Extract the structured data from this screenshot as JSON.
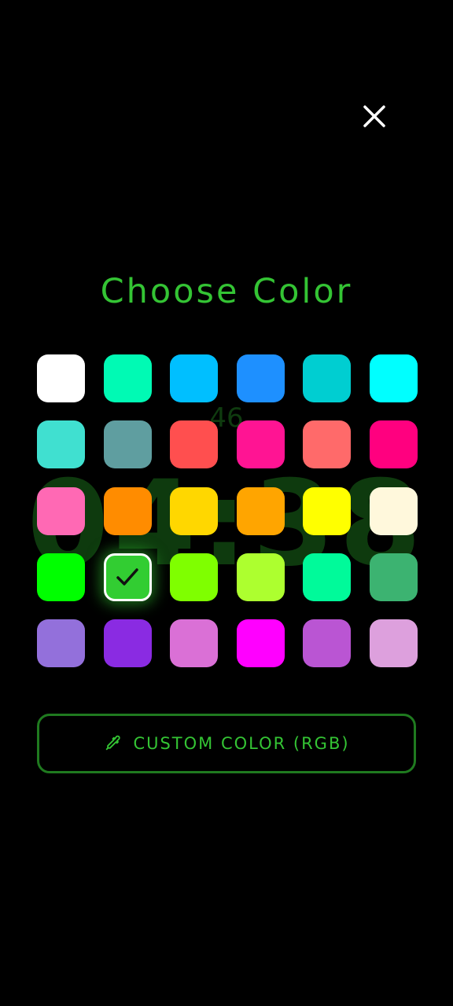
{
  "background_clock": {
    "seconds": "46",
    "time": "04:38",
    "date": ""
  },
  "dialog": {
    "title": "Choose Color",
    "close_icon": "close-icon",
    "selected_index": 19,
    "colors": [
      "#FFFFFF",
      "#00FAB4",
      "#00BFFF",
      "#1E90FF",
      "#00CED1",
      "#00FFFF",
      "#40E0D0",
      "#5F9EA0",
      "#FF4F4F",
      "#FF1493",
      "#FF6A6A",
      "#FF007F",
      "#FF69B4",
      "#FF8C00",
      "#FFD700",
      "#FFA500",
      "#FFFF00",
      "#FFF8DC",
      "#00FF00",
      "#32CD32",
      "#7FFF00",
      "#ADFF2F",
      "#00FA9A",
      "#3CB371",
      "#9370DB",
      "#8A2BE2",
      "#DA70D6",
      "#FF00FF",
      "#BA55D3",
      "#DDA0DD",
      "#FF4500",
      "#FF6347",
      "#FA8072",
      "#E9967A",
      "#F4A460",
      "#FFE4C4"
    ],
    "custom_button": {
      "label": "CUSTOM COLOR (RGB)",
      "icon": "eyedropper-icon"
    }
  },
  "theme": {
    "accent": "#34C434",
    "button_border": "#1F7A1F",
    "background": "#000000"
  }
}
